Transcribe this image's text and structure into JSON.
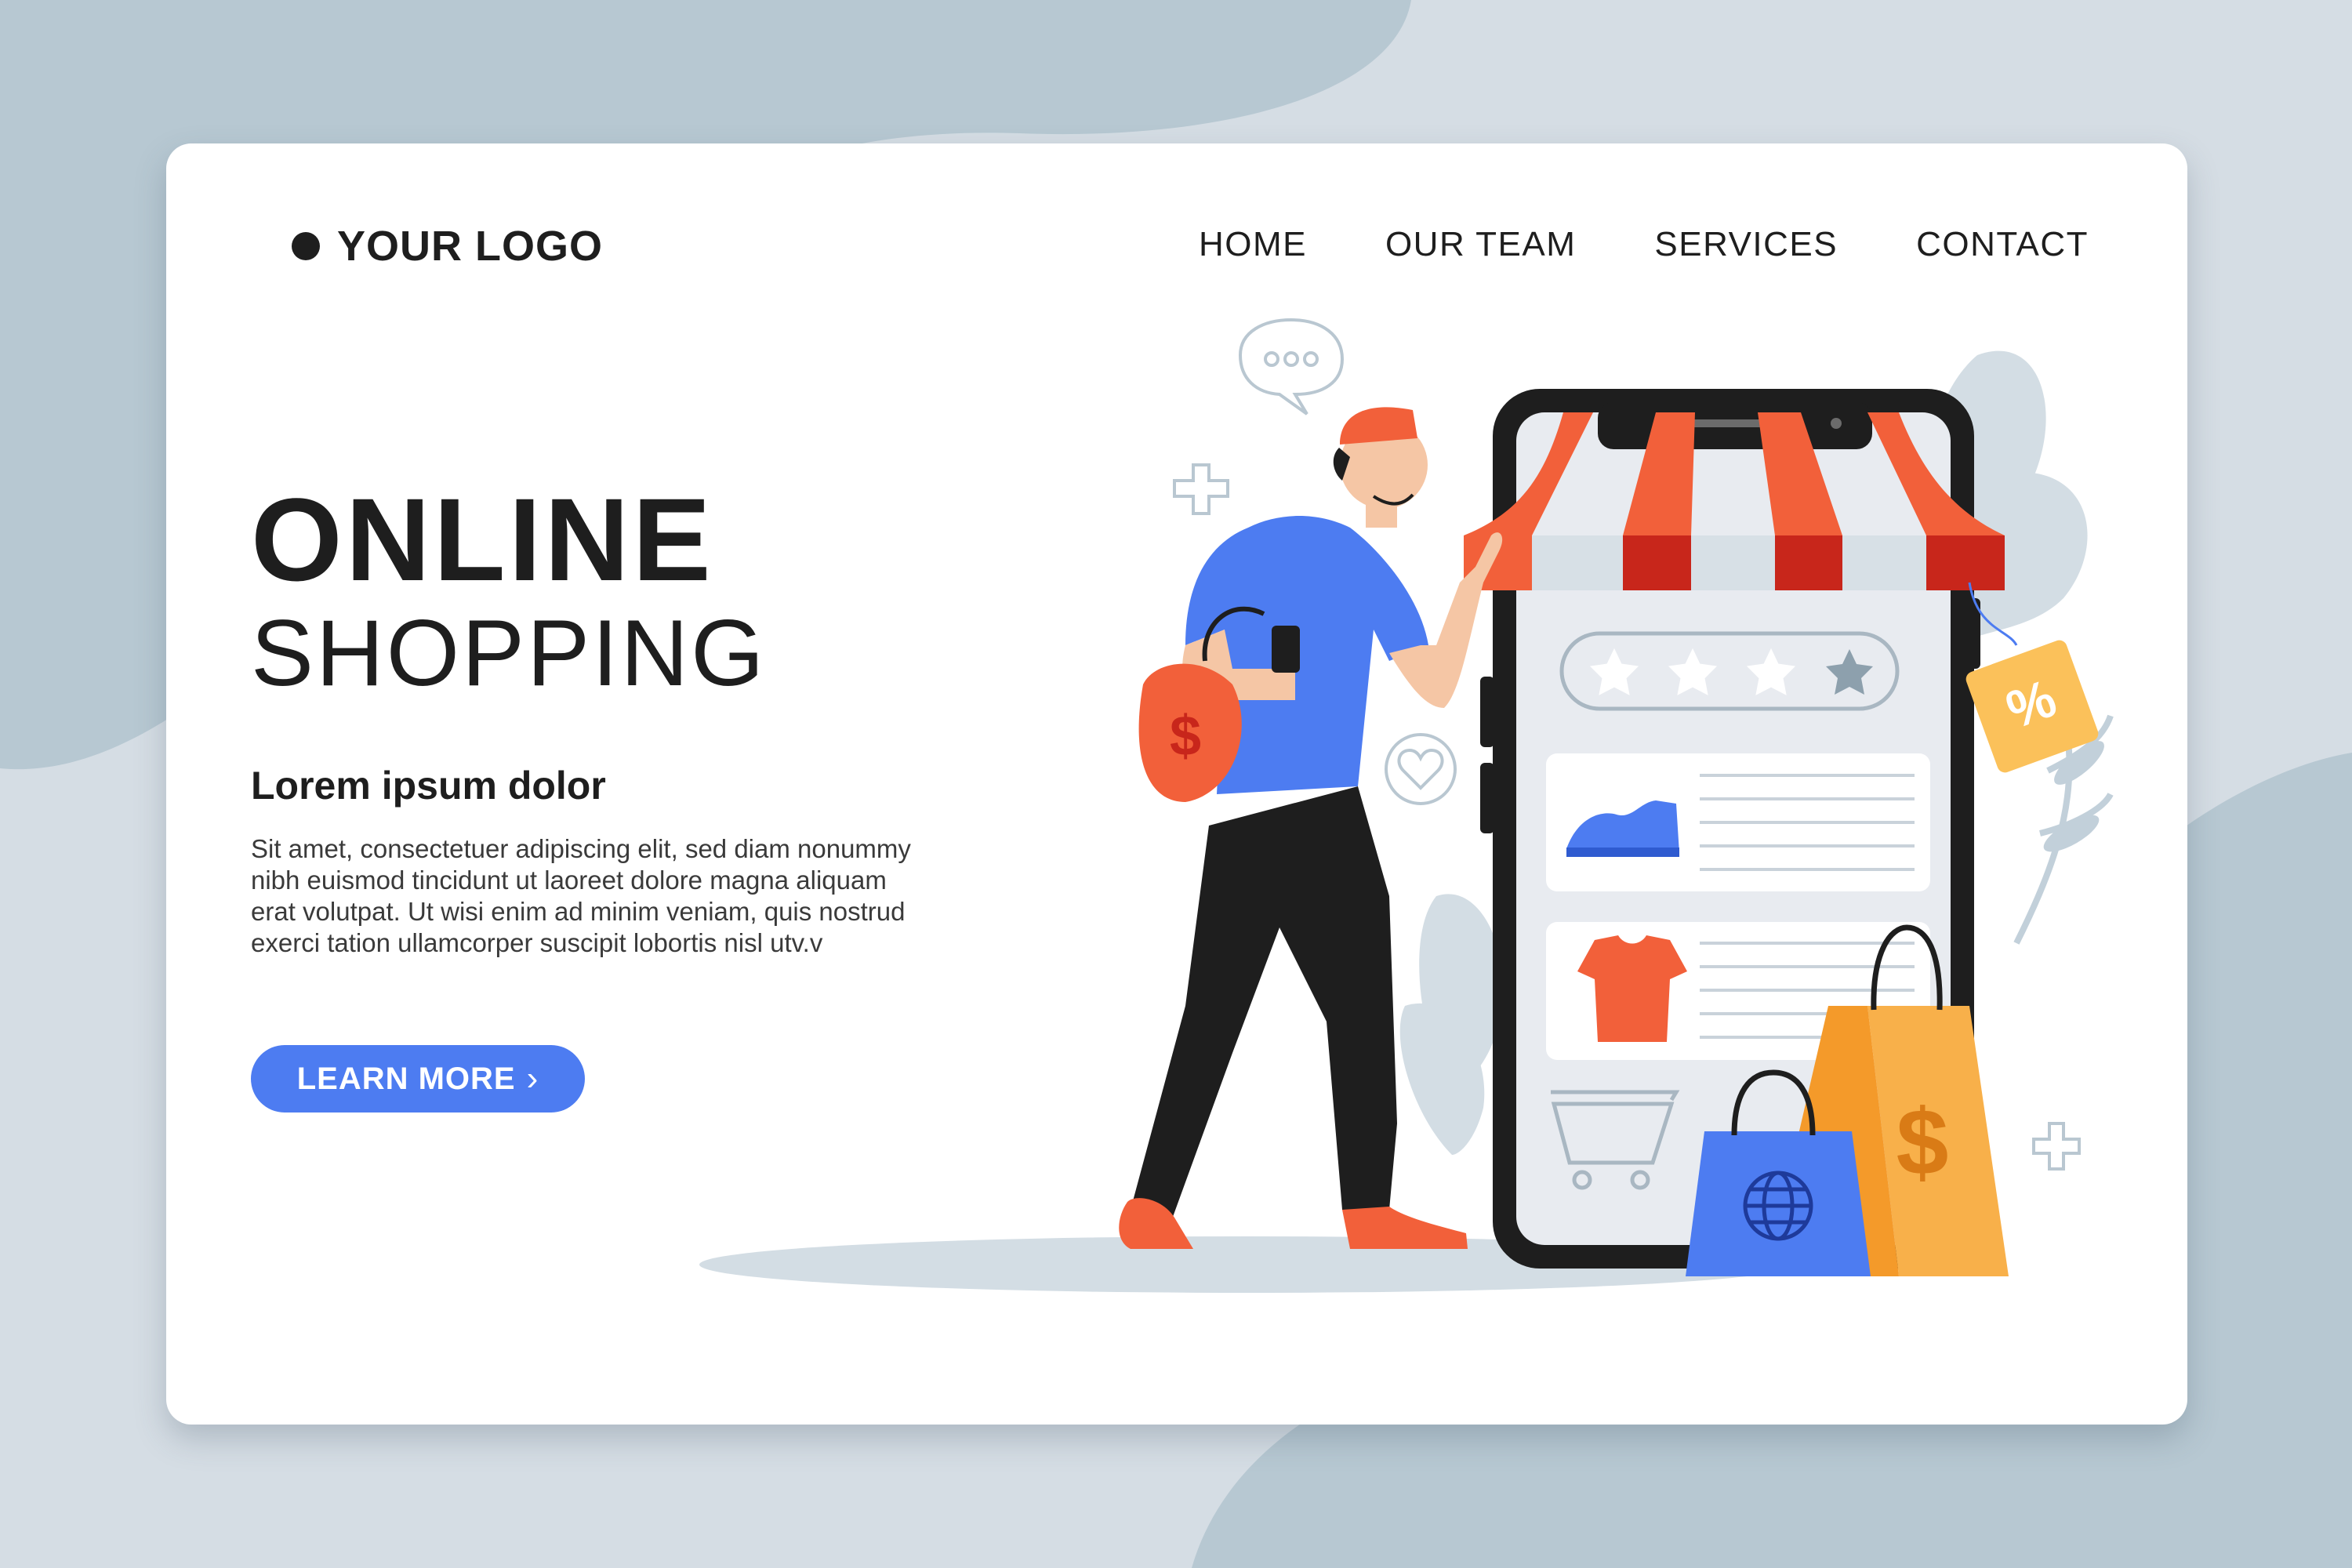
{
  "logo": {
    "text": "YOUR LOGO"
  },
  "nav": {
    "items": [
      "HOME",
      "OUR TEAM",
      "SERVICES",
      "CONTACT"
    ]
  },
  "hero": {
    "title_line1": "ONLINE",
    "title_line2": "SHOPPING",
    "subtitle": "Lorem ipsum dolor",
    "body": "Sit amet, consectetuer adipiscing elit, sed diam nonummy nibh euismod tincidunt ut laoreet dolore magna aliquam erat volutpat. Ut wisi enim ad minim veniam, quis nostrud exerci tation ullamcorper suscipit lobortis nisl utv.v",
    "cta": "LEARN MORE",
    "cta_chevron": "›"
  },
  "illustration": {
    "rating_stars_filled": 3,
    "rating_stars_total": 4,
    "discount_tag": "%",
    "currency_symbol": "$"
  },
  "colors": {
    "accent_blue": "#4d7cf1",
    "awning_orange": "#f2603a",
    "awning_red": "#c8261b",
    "bag_yellow": "#f8b04a",
    "tag_yellow": "#fbc15a",
    "phone_dark": "#1e1e1e",
    "screen_gray": "#e8ebf0",
    "background": "#d5dde4"
  }
}
